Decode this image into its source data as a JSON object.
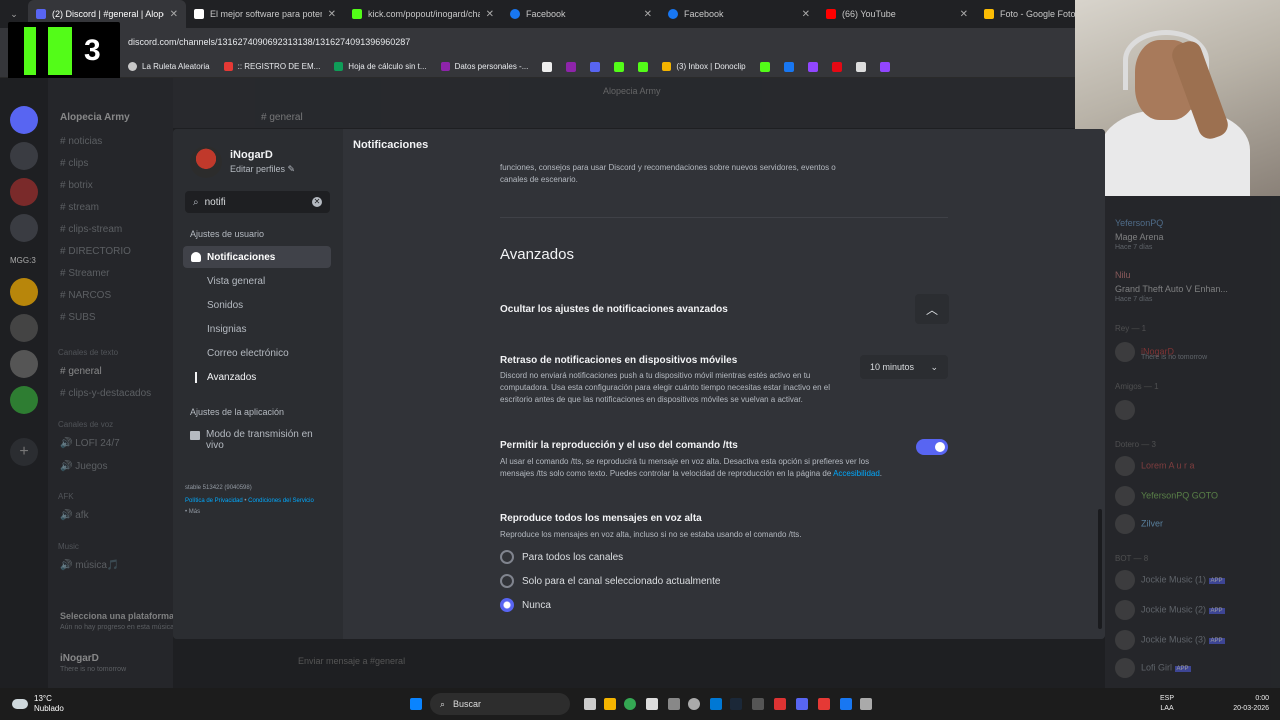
{
  "browser": {
    "tabs": [
      {
        "title": "(2) Discord | #general | Alopecia",
        "color": "#5865f2",
        "active": true
      },
      {
        "title": "El mejor software para potencia",
        "color": "#ffffff",
        "active": false
      },
      {
        "title": "kick.com/popout/inogard/chat",
        "color": "#53fc18",
        "active": false
      },
      {
        "title": "Facebook",
        "color": "#1877f2",
        "active": false
      },
      {
        "title": "Facebook",
        "color": "#1877f2",
        "active": false
      },
      {
        "title": "(66) YouTube",
        "color": "#ff0000",
        "active": false
      },
      {
        "title": "Foto - Google Fotos",
        "color": "#fbbc04",
        "active": false
      }
    ],
    "url": "discord.com/channels/1316274090692313138/1316274091396960287",
    "bookmarks": [
      {
        "label": "La Ruleta Aleatoria",
        "color": "#c8c8c8"
      },
      {
        "label": ":: REGISTRO DE EM...",
        "color": "#e53935"
      },
      {
        "label": "Hoja de cálculo sin t...",
        "color": "#0f9d58"
      },
      {
        "label": "Datos personales -...",
        "color": "#8e24aa"
      },
      {
        "label": "(3) Inbox | Donoclip",
        "color": "#f4b400"
      }
    ]
  },
  "overlay": {
    "kick_number": "3"
  },
  "discord_bg": {
    "server_name": "Alopecia Army",
    "channel_header": "general",
    "top_center": "Alopecia Army",
    "channels": [
      "noticias",
      "clips",
      "botrix",
      "stream",
      "clips-stream",
      "DIRECTORIO",
      "Streamer",
      "NARCOS",
      "SUBS"
    ],
    "category_text": "Canales de texto",
    "text_channels": [
      "general",
      "clips-y-destacados"
    ],
    "category_voice": "Canales de voz",
    "voice_channels": [
      "LOFI 24/7",
      "Juegos"
    ],
    "category_afk": "AFK",
    "afk_channels": [
      "afk"
    ],
    "category_music": "Music",
    "music_channels": [
      "música🎵"
    ],
    "platform_title": "Selecciona una plataforma",
    "platform_sub": "Aún no hay progreso en esta música",
    "bottom_user": "iNogarD",
    "bottom_status": "There is no tomorrow",
    "message_placeholder": "Enviar mensaje a #general",
    "guild_label": "MGG:3",
    "members": {
      "m1_name": "YefersonPQ",
      "m1_game": "Mage Arena",
      "m1_time": "Hace 7 días",
      "m2_name": "Nilu",
      "m2_game": "Grand Theft Auto V Enhan...",
      "m2_time": "Hace 7 días",
      "section_rey": "Rey — 1",
      "m3_name": "iNogarD",
      "m3_sub": "There is no tomorrow",
      "section_amigos": "Amigos — 1",
      "section_doteros": "Dotero — 3",
      "m4_name": "Lorem",
      "m4_extra": "A u r a",
      "m5_name": "YefersonPQ",
      "m5_extra": "GOTO",
      "m6_name": "Zilver",
      "section_bot": "BOT — 8",
      "bots": [
        "Jockie Music (1)",
        "Jockie Music (2)",
        "Jockie Music (3)",
        "Lofi Girl"
      ],
      "bot_tag": "APP"
    }
  },
  "settings": {
    "username": "iNogarD",
    "edit_profiles": "Editar perfiles ✎",
    "search_value": "notifi",
    "user_settings_header": "Ajustes de usuario",
    "active_item": "Notificaciones",
    "sub_items": [
      "Vista general",
      "Sonidos",
      "Insignias",
      "Correo electrónico"
    ],
    "current_sub": "Avanzados",
    "app_settings_header": "Ajustes de la aplicación",
    "stream_mode": "Modo de transmisión en vivo",
    "version": "stable 513422 (9040598)",
    "privacy": "Política de Privacidad",
    "sep": " • ",
    "terms": "Condiciones del Servicio",
    "more": " • Más",
    "page_title": "Notificaciones",
    "top_desc": "funciones, consejos para usar Discord y recomendaciones sobre nuevos servidores, eventos o canales de escenario.",
    "advanced_heading": "Avanzados",
    "hide_advanced": "Ocultar los ajustes de notificaciones avanzados",
    "mobile_delay_title": "Retraso de notificaciones en dispositivos móviles",
    "mobile_delay_desc": "Discord no enviará notificaciones push a tu dispositivo móvil mientras estés activo en tu computadora. Usa esta configuración para elegir cuánto tiempo necesitas estar inactivo en el escritorio antes de que las notificaciones en dispositivos móviles se vuelvan a activar.",
    "mobile_delay_value": "10 minutos",
    "tts_title": "Permitir la reproducción y el uso del comando /tts",
    "tts_desc": "Al usar el comando /tts, se reproducirá tu mensaje en voz alta. Desactiva esta opción si prefieres ver los mensajes /tts solo como texto. Puedes controlar la velocidad de reproducción en la página de ",
    "tts_link": "Accesibilidad",
    "tts_end": ".",
    "tts_enabled": true,
    "readall_title": "Reproduce todos los mensajes en voz alta",
    "readall_desc": "Reproduce los mensajes en voz alta, incluso si no se estaba usando el comando /tts.",
    "radio_options": [
      "Para todos los canales",
      "Solo para el canal seleccionado actualmente",
      "Nunca"
    ],
    "radio_selected": 2
  },
  "taskbar": {
    "temp": "13°C",
    "weather": "Nublado",
    "search": "Buscar",
    "lang1": "ESP",
    "lang2": "LAA",
    "time": "0:00",
    "date": "20-03-2026"
  },
  "colors": {
    "accent": "#5865f2",
    "link": "#00a8fc",
    "kick": "#53fc18"
  }
}
